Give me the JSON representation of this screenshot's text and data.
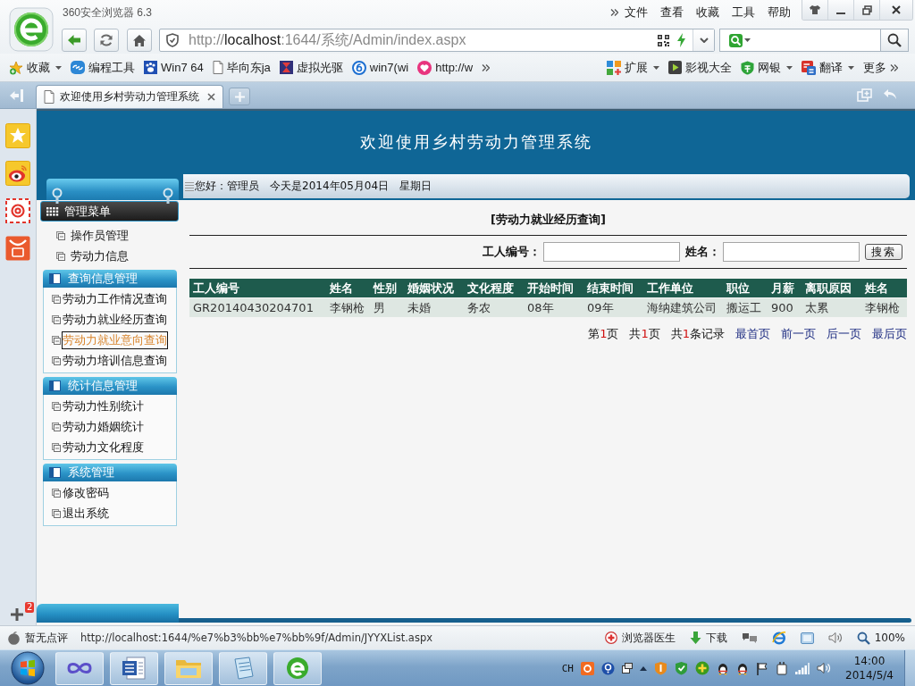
{
  "browser": {
    "title": "360安全浏览器 6.3",
    "menu": [
      "文件",
      "查看",
      "收藏",
      "工具",
      "帮助"
    ],
    "address": {
      "scheme": "http://",
      "host": "localhost",
      "path": ":1644/系统/Admin/index.aspx"
    },
    "bookmarks": [
      {
        "label": "收藏",
        "kind": "favorites",
        "dropdown": true
      },
      {
        "label": "编程工具",
        "kind": "link",
        "dropdown": false
      },
      {
        "label": "Win7 64",
        "kind": "paw",
        "dropdown": false
      },
      {
        "label": "毕向东ja",
        "kind": "page",
        "dropdown": false
      },
      {
        "label": "虚拟光驱",
        "kind": "hourglass",
        "dropdown": false
      },
      {
        "label": "win7(wi",
        "kind": "ring",
        "dropdown": false
      },
      {
        "label": "http://w",
        "kind": "heart",
        "dropdown": false
      }
    ],
    "extensions": [
      {
        "label": "扩展",
        "kind": "apps",
        "dropdown": true
      },
      {
        "label": "影视大全",
        "kind": "film",
        "dropdown": false
      },
      {
        "label": "网银",
        "kind": "shield",
        "dropdown": true
      },
      {
        "label": "翻译",
        "kind": "translate",
        "dropdown": true
      },
      {
        "label": "更多",
        "kind": "more",
        "dropdown": false
      }
    ],
    "tabs": [
      {
        "label": "欢迎使用乡村劳动力管理系统",
        "selected": true
      }
    ]
  },
  "side_dock": {
    "badge": "2"
  },
  "app": {
    "title": "欢迎使用乡村劳动力管理系统",
    "greeting": "您好：管理员",
    "today": "今天是2014年05月04日",
    "weekday": "星期日",
    "menu": {
      "title": "管理菜单",
      "items": [
        {
          "label": "操作员管理",
          "highlighted": false
        },
        {
          "label": "劳动力信息",
          "highlighted": false
        }
      ]
    },
    "sections": [
      {
        "title": "查询信息管理",
        "items": [
          {
            "label": "劳动力工作情况查询",
            "highlighted": false
          },
          {
            "label": "劳动力就业经历查询",
            "highlighted": false
          },
          {
            "label": "劳动力就业意向查询",
            "highlighted": true
          },
          {
            "label": "劳动力培训信息查询",
            "highlighted": false
          }
        ]
      },
      {
        "title": "统计信息管理",
        "items": [
          {
            "label": "劳动力性别统计",
            "highlighted": false
          },
          {
            "label": "劳动力婚姻统计",
            "highlighted": false
          },
          {
            "label": "劳动力文化程度",
            "highlighted": false
          }
        ]
      },
      {
        "title": "系统管理",
        "items": [
          {
            "label": "修改密码",
            "highlighted": false
          },
          {
            "label": "退出系统",
            "highlighted": false
          }
        ]
      }
    ],
    "page_title": "[劳动力就业经历查询]",
    "filters": [
      {
        "label": "工人编号："
      },
      {
        "label": "姓名："
      }
    ],
    "search_button": "搜索",
    "table": {
      "columns": [
        "工人编号",
        "姓名",
        "性别",
        "婚姻状况",
        "文化程度",
        "开始时间",
        "结束时间",
        "工作单位",
        "职位",
        "月薪",
        "离职原因",
        "姓名"
      ],
      "rows": [
        [
          "GR20140430204701",
          "李钢枪",
          "男",
          "未婚",
          "务农",
          "08年",
          "09年",
          "海纳建筑公司",
          "搬运工",
          "900",
          "太累",
          "李钢枪"
        ]
      ]
    },
    "pager": {
      "info": [
        {
          "prefix": "第",
          "number": "1",
          "suffix": "页"
        },
        {
          "prefix": "共",
          "number": "1",
          "suffix": "页"
        },
        {
          "prefix": "共",
          "number": "1",
          "suffix": "条记录"
        }
      ],
      "links": [
        "最首页",
        "前一页",
        "后一页",
        "最后页"
      ]
    }
  },
  "status_bar": {
    "rating": "暂无点评",
    "url": "http://localhost:1644/%e7%b3%bb%e7%bb%9f/Admin/JYYXList.aspx",
    "tools": [
      {
        "label": "浏览器医生",
        "kind": "doctor"
      },
      {
        "label": "下载",
        "kind": "download"
      }
    ],
    "zoom": "100%"
  },
  "taskbar": {
    "language": "CH",
    "time": "14:00",
    "date": "2014/5/4"
  }
}
